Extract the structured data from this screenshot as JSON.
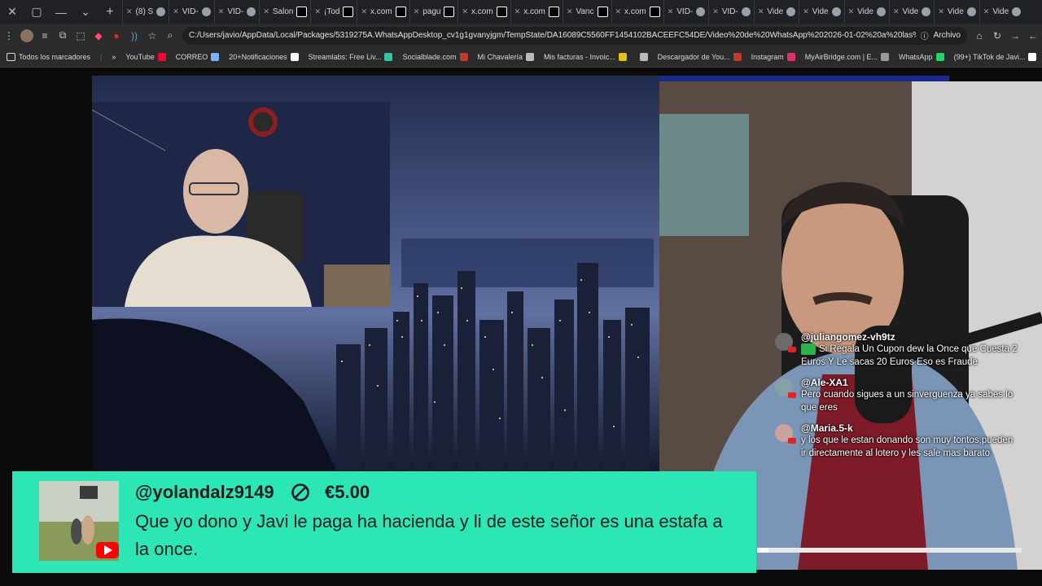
{
  "tabs": [
    {
      "label": "(8) S",
      "icon": "chrome-icon",
      "color": "#9aa0a6"
    },
    {
      "label": "VID-",
      "icon": "chrome-icon",
      "color": "#9aa0a6"
    },
    {
      "label": "VID-",
      "icon": "chrome-icon",
      "color": "#9aa0a6"
    },
    {
      "label": "Salon",
      "icon": "x-icon",
      "color": "#ffffff"
    },
    {
      "label": "¡Tod",
      "icon": "x-icon",
      "color": "#ffffff"
    },
    {
      "label": "x.com",
      "icon": "x-icon",
      "color": "#ffffff"
    },
    {
      "label": "pagu",
      "icon": "x-icon",
      "color": "#ffffff"
    },
    {
      "label": "x.com",
      "icon": "x-icon",
      "color": "#ffffff"
    },
    {
      "label": "x.com",
      "icon": "x-icon",
      "color": "#ffffff"
    },
    {
      "label": "Vanc",
      "icon": "x-icon",
      "color": "#ffffff"
    },
    {
      "label": "x.com",
      "icon": "x-icon",
      "color": "#ffffff"
    },
    {
      "label": "VID-",
      "icon": "chrome-icon",
      "color": "#9aa0a6"
    },
    {
      "label": "VID-",
      "icon": "chrome-icon",
      "color": "#9aa0a6"
    },
    {
      "label": "Vide",
      "icon": "chrome-icon",
      "color": "#9aa0a6"
    },
    {
      "label": "Vide",
      "icon": "chrome-icon",
      "color": "#9aa0a6"
    },
    {
      "label": "Vide",
      "icon": "chrome-icon",
      "color": "#9aa0a6"
    },
    {
      "label": "Vide",
      "icon": "chrome-icon",
      "color": "#9aa0a6"
    },
    {
      "label": "Vide",
      "icon": "chrome-icon",
      "color": "#9aa0a6"
    },
    {
      "label": "Vide",
      "icon": "chrome-icon",
      "color": "#9aa0a6"
    }
  ],
  "addressbar": {
    "url": "C:/Users/javio/AppData/Local/Packages/5319275A.WhatsAppDesktop_cv1g1gvanyjgm/TempState/DA16089C5560FF1454102BACEEFC54DE/Video%20de%20WhatsApp%202026-01-02%20a%20las%2020.49....",
    "archivo": "Archivo"
  },
  "bookmarks": [
    {
      "label": "YouTube",
      "color": "#ff0033"
    },
    {
      "label": "CORREO",
      "color": "#7ab0ff"
    },
    {
      "label": "20+Notificaciones",
      "color": "#ffffff"
    },
    {
      "label": "Streamlabs: Free Liv...",
      "color": "#31c3a2"
    },
    {
      "label": "Socialblade.com",
      "color": "#c0392b"
    },
    {
      "label": "Mi Chavalería",
      "color": "#bbbbbb"
    },
    {
      "label": "Mis facturas - Invoic...",
      "color": "#e4c21a"
    },
    {
      "label": "",
      "color": "#bbbbbb"
    },
    {
      "label": "Descargador de You...",
      "color": "#c0392b"
    },
    {
      "label": "Instagram",
      "color": "#e1306c"
    },
    {
      "label": "MyAirBridge.com | E...",
      "color": "#999999"
    },
    {
      "label": "WhatsApp",
      "color": "#25d366"
    },
    {
      "label": "(99+) TikTok de Javi...",
      "color": "#ffffff"
    }
  ],
  "bookmarks_all": "Todos los marcadores",
  "chat": [
    {
      "user": "@juliangomez-vh9tz",
      "text": "Si Regala Un Cupon dew la Once que Cuesta 2 Euros Y Le sacas 20 Euros Eso es Fraude",
      "emote": true
    },
    {
      "user": "@Ale-XA1",
      "text": "Pero cuando sigues a un sinverguenza ya sabes lo que eres",
      "emote": false
    },
    {
      "user": "@Maria.5-k",
      "text": "y los que le estan donando son muy tontos,pueden ir directamente al lotero y les sale mas barato",
      "emote": false
    }
  ],
  "superchat": {
    "user": "@yolandalz9149",
    "amount": "€5.00",
    "message": "Que yo dono y Javi le paga ha hacienda y li de este señor es una estafa a la once.",
    "color": "#2de6b5"
  }
}
